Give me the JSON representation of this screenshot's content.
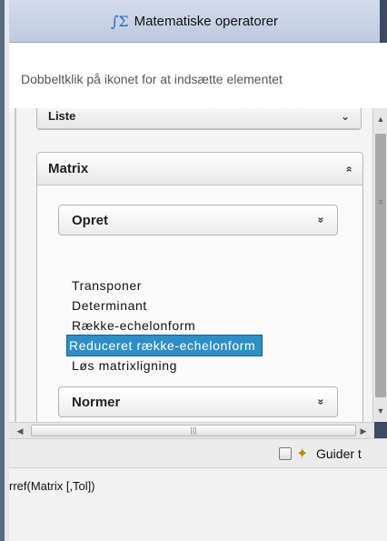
{
  "panel": {
    "title": "Matematiske operatorer",
    "title_icon": "integral-sigma-icon",
    "hint": "Dobbeltklik på ikonet for at indsætte elementet"
  },
  "sections": {
    "liste_label": "Liste",
    "matrix_label": "Matrix",
    "matrix_chevron": "»",
    "opret_label": "Opret",
    "normer_label": "Normer",
    "sub_chevron": "»",
    "commands": [
      {
        "label": "Transponer",
        "selected": false
      },
      {
        "label": "Determinant",
        "selected": false
      },
      {
        "label": "Række-echelonform",
        "selected": false
      },
      {
        "label": "Reduceret række-echelonform",
        "selected": true
      },
      {
        "label": "Løs matrixligning",
        "selected": false
      }
    ]
  },
  "scrollbars": {
    "up_arrow": "▲",
    "down_arrow": "▼",
    "left_arrow": "◀",
    "right_arrow": "▶",
    "grip": "|||",
    "side_grip": "≡"
  },
  "bottom": {
    "guide_label": "Guider t",
    "wand_icon": "magic-wand-icon"
  },
  "syntax": {
    "text": "rref(Matrix [,Tol])"
  },
  "colors": {
    "selection": "#2e8ec6",
    "title_bar": "#c8d3e6"
  }
}
